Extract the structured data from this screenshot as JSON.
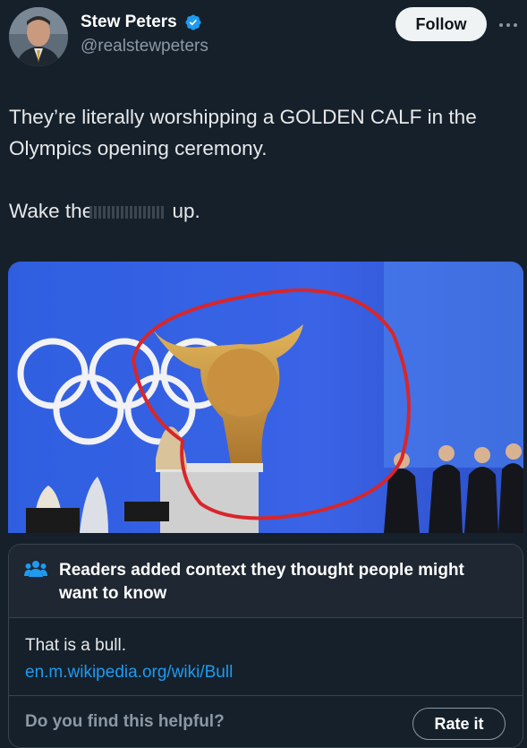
{
  "author": {
    "display_name": "Stew Peters",
    "handle": "@realstewpeters",
    "verified": true,
    "follow_label": "Follow"
  },
  "tweet": {
    "line1": "They’re literally worshipping a GOLDEN CALF in the Olympics opening ceremony.",
    "line2_before": "Wake the",
    "line2_after": "up."
  },
  "community_note": {
    "title": "Readers added context they thought people might want to know",
    "body": "That is a bull.",
    "link": "en.m.wikipedia.org/wiki/Bull",
    "helpful_question": "Do you find this helpful?",
    "rate_label": "Rate it"
  },
  "colors": {
    "background": "#15202b",
    "accent": "#1d9bf0",
    "verified": "#1d9bf0",
    "annotation_circle": "#d8262a"
  }
}
